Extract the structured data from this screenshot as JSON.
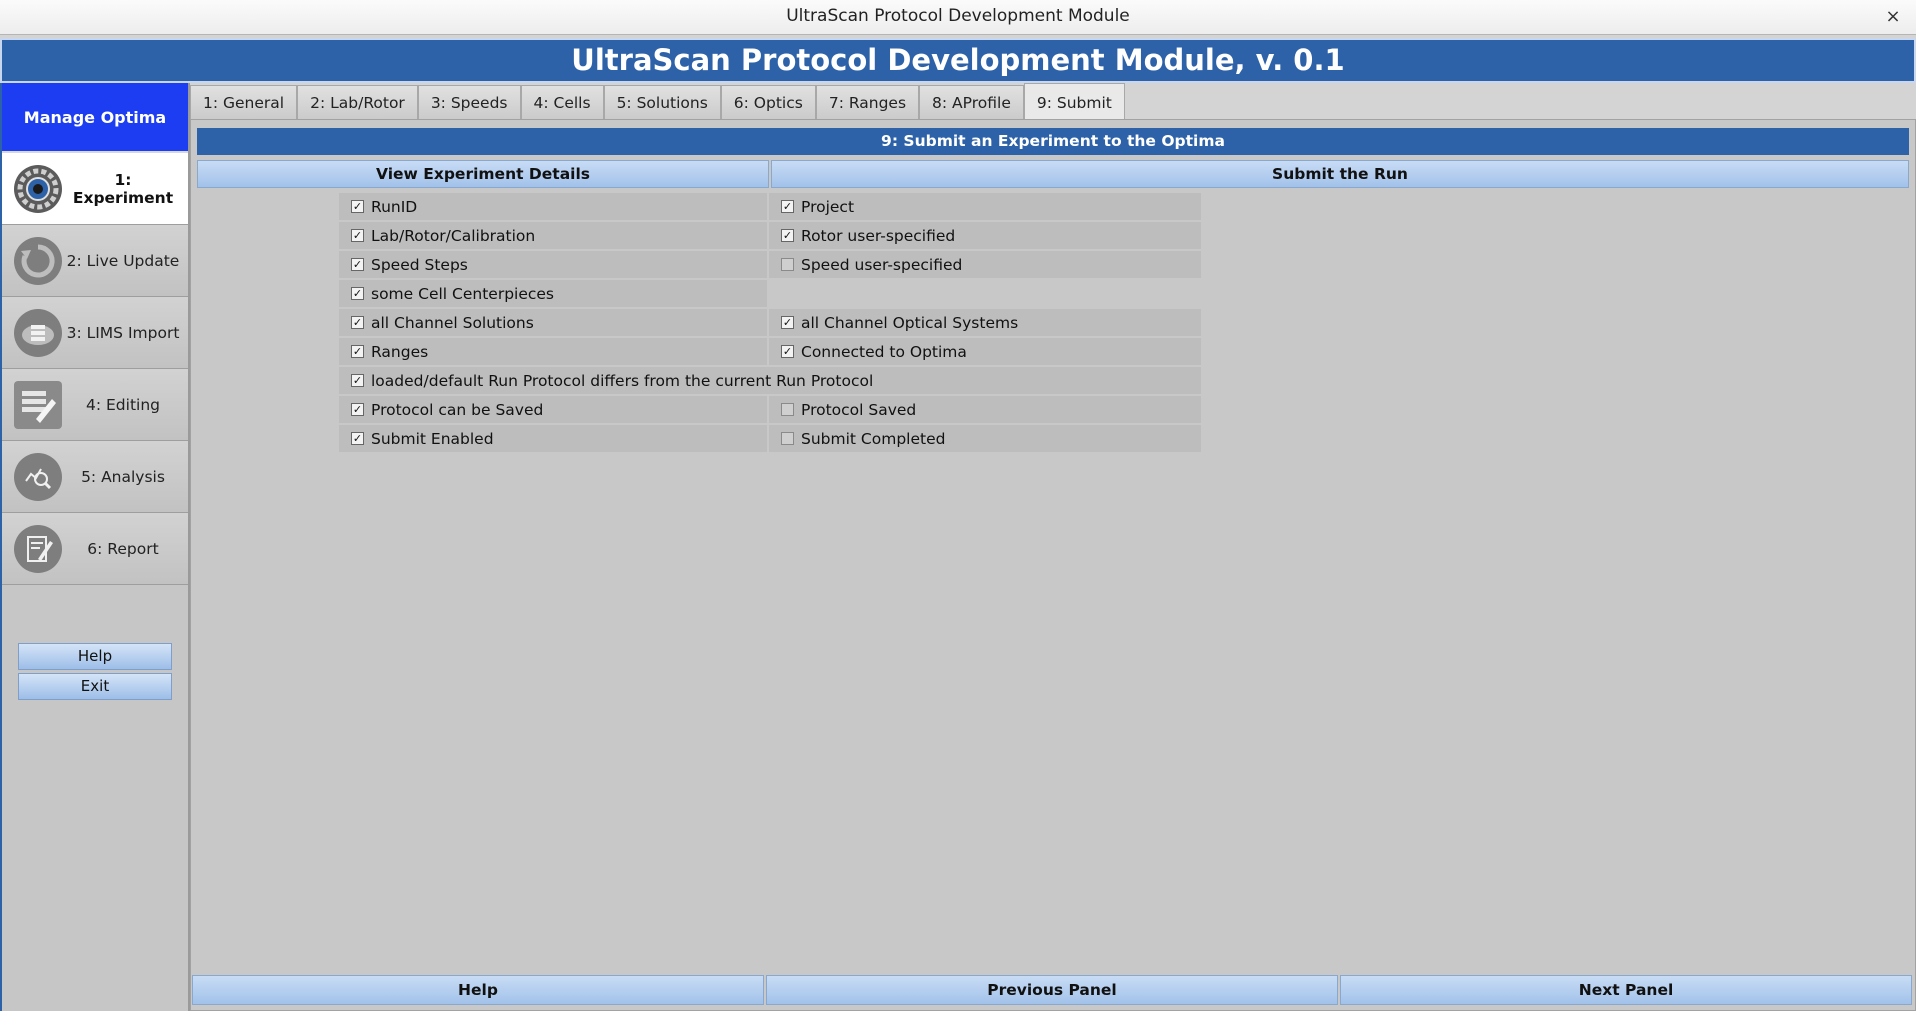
{
  "window": {
    "title": "UltraScan Protocol Development Module",
    "close_glyph": "×"
  },
  "banner": {
    "title": "UltraScan Protocol Development Module, v. 0.1"
  },
  "sidebar": {
    "header": "Manage Optima Runs",
    "items": [
      {
        "label": "1: Experiment",
        "icon": "gear-icon",
        "active": true
      },
      {
        "label": "2: Live Update",
        "icon": "refresh-icon",
        "active": false
      },
      {
        "label": "3: LIMS Import",
        "icon": "cloud-database-icon",
        "active": false
      },
      {
        "label": "4: Editing",
        "icon": "edit-icon",
        "active": false
      },
      {
        "label": "5: Analysis",
        "icon": "analysis-search-icon",
        "active": false
      },
      {
        "label": "6: Report",
        "icon": "report-icon",
        "active": false
      }
    ],
    "help_label": "Help",
    "exit_label": "Exit"
  },
  "tabs": [
    {
      "label": "1: General",
      "active": false
    },
    {
      "label": "2: Lab/Rotor",
      "active": false
    },
    {
      "label": "3: Speeds",
      "active": false
    },
    {
      "label": "4: Cells",
      "active": false
    },
    {
      "label": "5: Solutions",
      "active": false
    },
    {
      "label": "6: Optics",
      "active": false
    },
    {
      "label": "7: Ranges",
      "active": false
    },
    {
      "label": "8: AProfile",
      "active": false
    },
    {
      "label": "9: Submit",
      "active": true
    }
  ],
  "panel": {
    "title": "9: Submit an Experiment to the Optima",
    "left_header": "View Experiment Details",
    "right_header": "Submit the Run",
    "rows": [
      {
        "left": {
          "label": "RunID",
          "checked": true
        },
        "right": {
          "label": "Project",
          "checked": true
        }
      },
      {
        "left": {
          "label": "Lab/Rotor/Calibration",
          "checked": true
        },
        "right": {
          "label": "Rotor user-specified",
          "checked": true
        }
      },
      {
        "left": {
          "label": "Speed Steps",
          "checked": true
        },
        "right": {
          "label": "Speed user-specified",
          "checked": false
        }
      },
      {
        "left": {
          "label": "some Cell Centerpieces",
          "checked": true
        },
        "right": null
      },
      {
        "left": {
          "label": "all Channel Solutions",
          "checked": true
        },
        "right": {
          "label": "all Channel Optical Systems",
          "checked": true
        }
      },
      {
        "left": {
          "label": "Ranges",
          "checked": true
        },
        "right": {
          "label": "Connected to Optima",
          "checked": true
        }
      },
      {
        "wide": {
          "label": "loaded/default Run Protocol differs from the current Run Protocol",
          "checked": true
        }
      },
      {
        "left": {
          "label": "Protocol can be Saved",
          "checked": true
        },
        "right": {
          "label": "Protocol Saved",
          "checked": false
        }
      },
      {
        "left": {
          "label": "Submit Enabled",
          "checked": true
        },
        "right": {
          "label": "Submit Completed",
          "checked": false
        }
      }
    ]
  },
  "footer": {
    "help_label": "Help",
    "previous_label": "Previous Panel",
    "next_label": "Next Panel"
  },
  "colors": {
    "banner_blue": "#2e62a8",
    "sidebar_header_blue": "#1c3df2",
    "button_blue": "#a2c2ea"
  }
}
